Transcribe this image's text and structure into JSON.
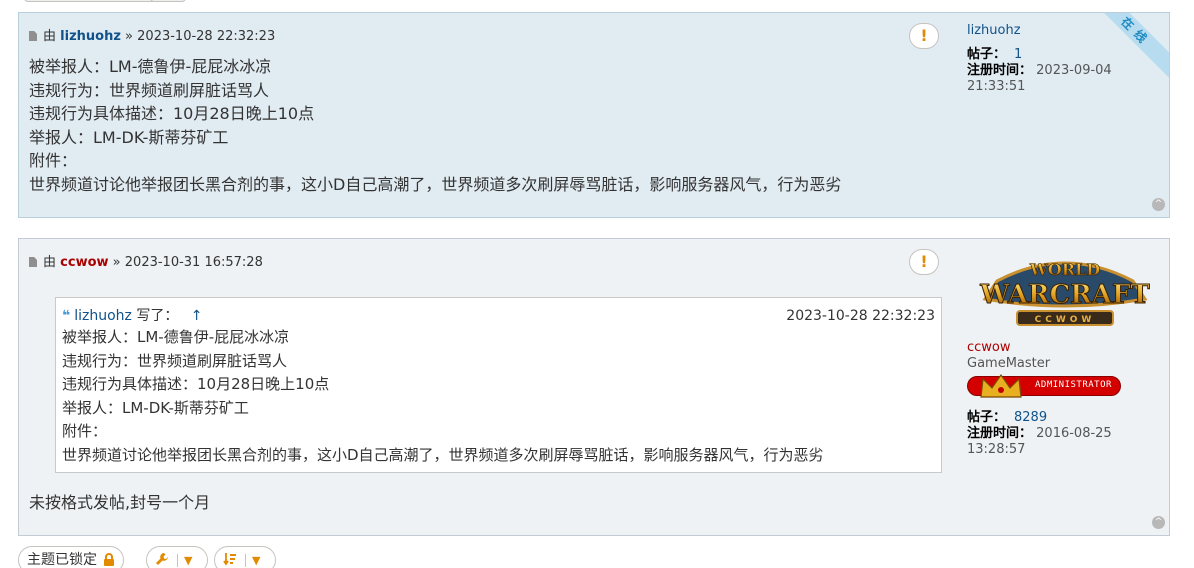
{
  "posts": [
    {
      "prefix": "由",
      "author": "lizhuohz",
      "sep": "»",
      "time": "2023-10-28 22:32:23",
      "lines": [
        "被举报人：LM-德鲁伊-屁屁冰冰凉",
        "违规行为：世界频道刷屏脏话骂人",
        "违规行为具体描述：10月28日晚上10点",
        "举报人：LM-DK-斯蒂芬矿工",
        "附件：",
        "世界频道讨论他举报团长黑合剂的事，这小D自己高潮了，世界频道多次刷屏辱骂脏话，影响服务器风气，行为恶劣"
      ],
      "profile": {
        "name": "lizhuohz",
        "posts_label": "帖子：",
        "posts": "1",
        "joined_label": "注册时间：",
        "joined_date": "2023-09-04",
        "joined_time": "21:33:51",
        "online_ribbon": "在线"
      }
    },
    {
      "prefix": "由",
      "author": "ccwow",
      "sep": "»",
      "time": "2023-10-31 16:57:28",
      "quote": {
        "mark": "❝",
        "author": "lizhuohz",
        "wrote": "写了：",
        "up": "↑",
        "time": "2023-10-28 22:32:23",
        "lines": [
          "被举报人：LM-德鲁伊-屁屁冰冰凉",
          "违规行为：世界频道刷屏脏话骂人",
          "违规行为具体描述：10月28日晚上10点",
          "举报人：LM-DK-斯蒂芬矿工",
          "附件：",
          "世界频道讨论他举报团长黑合剂的事，这小D自己高潮了，世界频道多次刷屏辱骂脏话，影响服务器风气，行为恶劣"
        ]
      },
      "reply": "未按格式发帖,封号一个月",
      "profile": {
        "avatar_top": "WORLD",
        "avatar_main": "WARCRAFT",
        "avatar_sub": "CCWOW",
        "name": "ccwow",
        "rank": "GameMaster",
        "badge_label": "ADMINISTRATOR",
        "posts_label": "帖子：",
        "posts": "8289",
        "joined_label": "注册时间：",
        "joined_date": "2016-08-25",
        "joined_time": "13:28:57"
      }
    }
  ],
  "report_icon": "!",
  "top_icon": "^",
  "bottom": {
    "locked_label": "主题已锁定",
    "lock_icon": "lock-icon",
    "tools_icon": "wrench-icon",
    "sort_icon": "sort-icon",
    "caret": "▼"
  },
  "colors": {
    "post1_bg": "#e1ebf2",
    "post2_bg": "#eef2f5",
    "link": "#105289",
    "admin_name": "#aa0000",
    "accent": "#e28a00",
    "badge": "#d40000"
  }
}
